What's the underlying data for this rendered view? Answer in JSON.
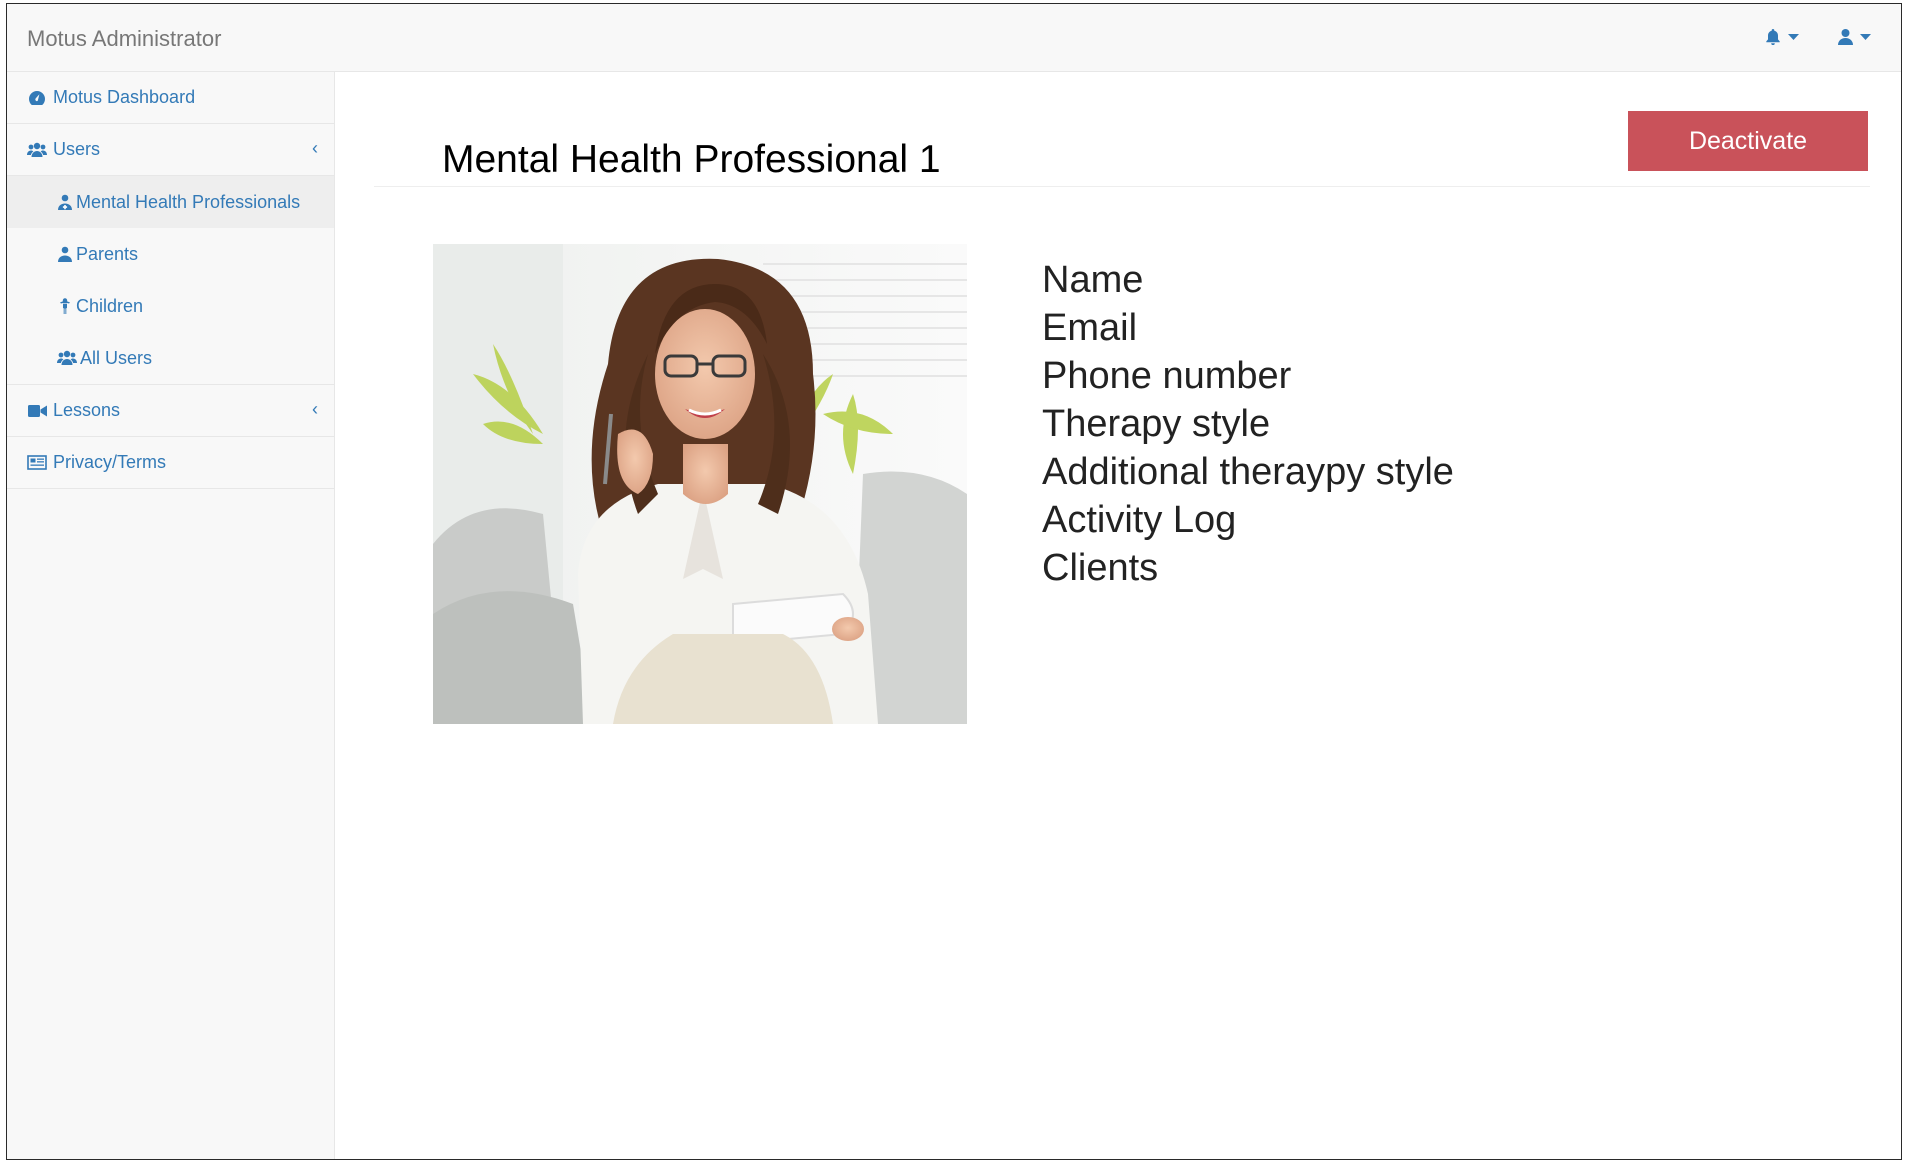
{
  "navbar": {
    "brand": "Motus Administrator",
    "alerts_icon": "bell-icon",
    "user_icon": "user-icon"
  },
  "sidebar": {
    "items": [
      {
        "label": "Motus Dashboard",
        "icon": "dashboard-icon"
      },
      {
        "label": "Users",
        "icon": "users-icon",
        "expanded": true,
        "children": [
          {
            "label": "Mental Health Professionals",
            "icon": "user-md-icon",
            "active": true
          },
          {
            "label": "Parents",
            "icon": "user-icon"
          },
          {
            "label": "Children",
            "icon": "child-icon"
          },
          {
            "label": "All Users",
            "icon": "users-icon"
          }
        ]
      },
      {
        "label": "Lessons",
        "icon": "video-camera-icon"
      },
      {
        "label": "Privacy/Terms",
        "icon": "newspaper-icon"
      }
    ]
  },
  "main": {
    "title": "Mental Health Professional 1",
    "deactivate_label": "Deactivate",
    "photo_alt": "portrait-photo",
    "fields": [
      "Name",
      "Email",
      "Phone number",
      "Therapy style",
      "Additional theraypy style",
      "Activity Log",
      "Clients"
    ]
  },
  "colors": {
    "link": "#337ab7",
    "danger": "#c9525a",
    "sidebar_bg": "#f8f8f8",
    "active_bg": "#eeeeee"
  }
}
